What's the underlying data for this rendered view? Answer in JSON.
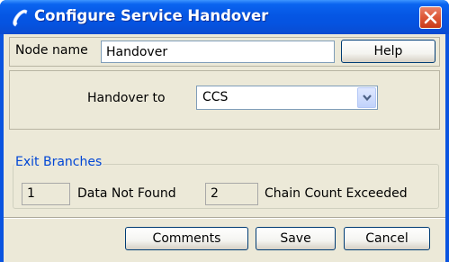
{
  "window": {
    "title": "Configure Service Handover",
    "icon": "phone-handset-icon",
    "close_icon": "close-icon"
  },
  "node_name": {
    "label": "Node name",
    "value": "Handover",
    "help_label": "Help"
  },
  "handover": {
    "label": "Handover to",
    "selected": "CCS"
  },
  "exit_branches": {
    "title": "Exit Branches",
    "branches": [
      {
        "number": "1",
        "label": "Data Not Found"
      },
      {
        "number": "2",
        "label": "Chain Count Exceeded"
      }
    ]
  },
  "footer": {
    "comments_label": "Comments",
    "save_label": "Save",
    "cancel_label": "Cancel"
  },
  "colors": {
    "titlebar": "#0553e0",
    "client": "#ece9d8",
    "legend": "#0046d5",
    "close": "#de5a3a"
  }
}
